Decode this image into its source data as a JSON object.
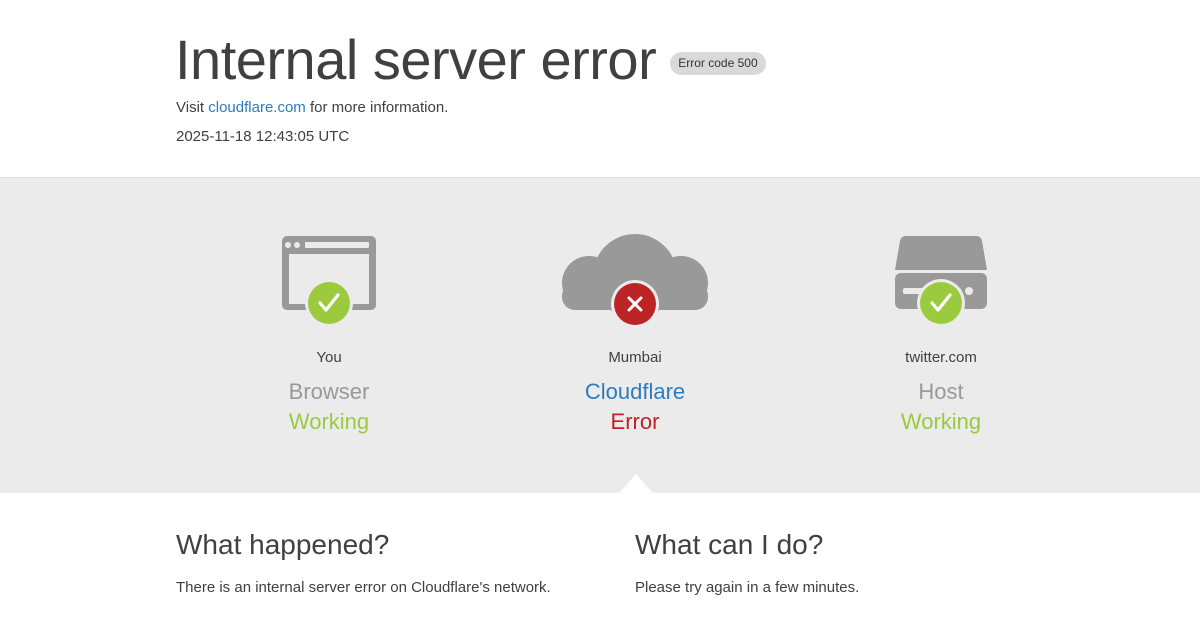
{
  "header": {
    "title": "Internal server error",
    "badge": "Error code 500",
    "info_prefix": "Visit",
    "info_link": "cloudflare.com",
    "info_suffix": "for more information.",
    "timestamp": "2025-11-18 12:43:05 UTC"
  },
  "status": {
    "you": {
      "label": "You",
      "kind": "Browser",
      "state": "Working",
      "icon": "browser-icon",
      "badge_icon": "checkmark-icon"
    },
    "cloudflare": {
      "label": "Mumbai",
      "kind": "Cloudflare",
      "state": "Error",
      "icon": "cloud-icon",
      "badge_icon": "x-icon"
    },
    "host": {
      "label": "twitter.com",
      "kind": "Host",
      "state": "Working",
      "icon": "server-icon",
      "badge_icon": "checkmark-icon"
    }
  },
  "what_happened": {
    "heading": "What happened?",
    "body": "There is an internal server error on Cloudflare's network."
  },
  "what_can_i_do": {
    "heading": "What can I do?",
    "body": "Please try again in a few minutes."
  },
  "colors": {
    "ok": "#9bca3e",
    "error": "#bd2426",
    "link": "#2f7bbf",
    "icon_gray": "#999999",
    "band_bg": "#ebebeb"
  }
}
